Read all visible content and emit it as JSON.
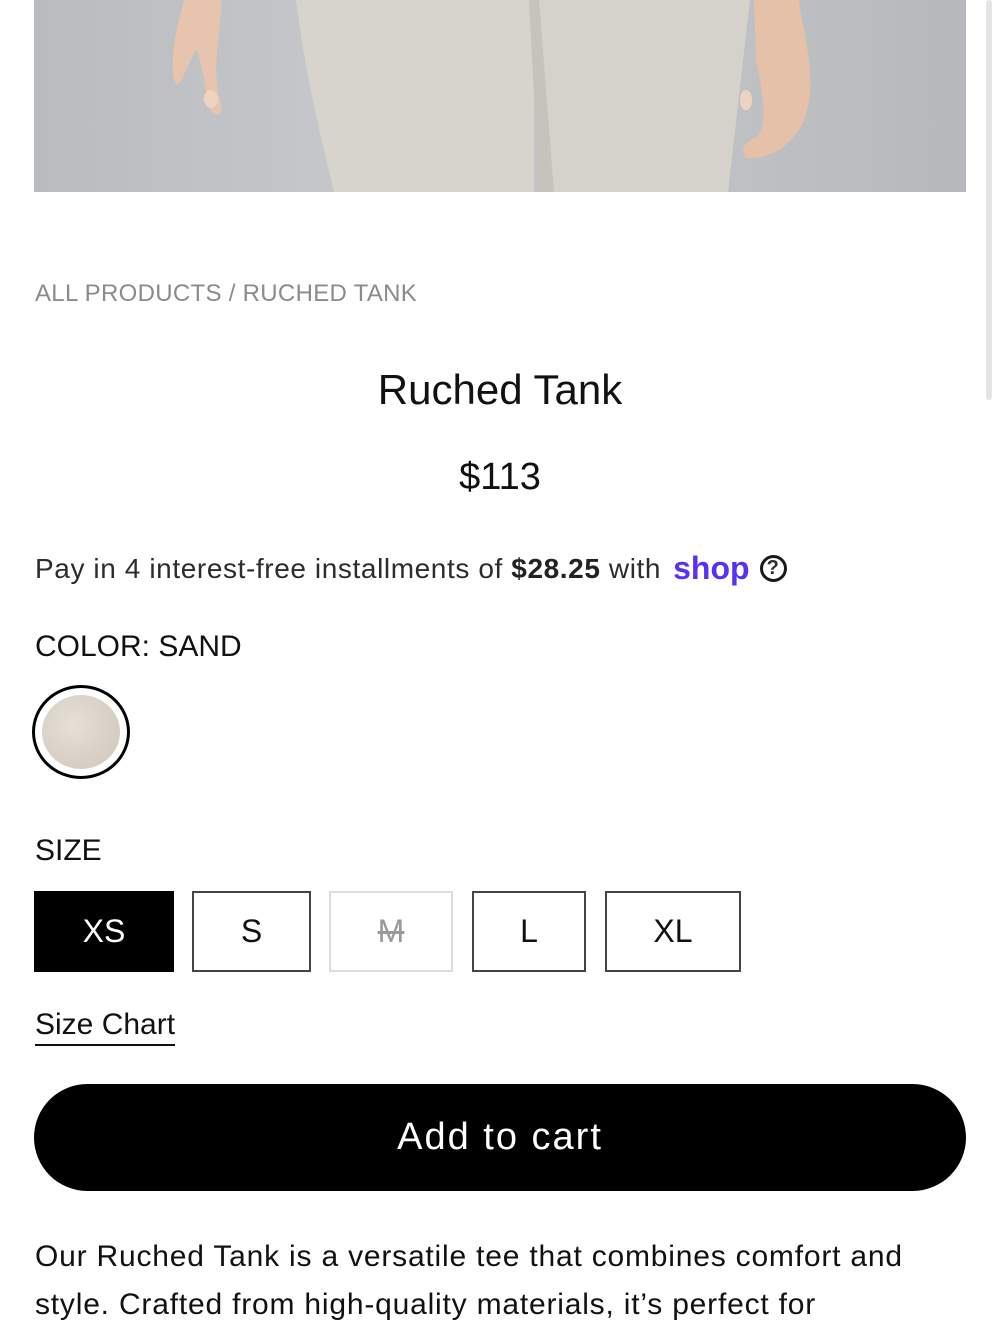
{
  "breadcrumb": {
    "root": "ALL PRODUCTS",
    "separator": " / ",
    "current": "RUCHED TANK"
  },
  "product": {
    "title": "Ruched Tank",
    "price": "$113"
  },
  "installments": {
    "prefix": "Pay in 4 interest-free installments of ",
    "amount": "$28.25",
    "suffix": " with",
    "provider": "shop",
    "help_glyph": "?"
  },
  "color": {
    "label": "COLOR: SAND",
    "selected": "Sand",
    "swatch_hex": "#d9d1c7"
  },
  "size": {
    "label": "SIZE",
    "options": [
      {
        "label": "XS",
        "state": "selected"
      },
      {
        "label": "S",
        "state": "available"
      },
      {
        "label": "M",
        "state": "sold-out"
      },
      {
        "label": "L",
        "state": "available"
      },
      {
        "label": "XL",
        "state": "available"
      }
    ]
  },
  "size_chart_link": "Size Chart",
  "add_to_cart": "Add to cart",
  "description": "Our Ruched Tank is a versatile tee that combines comfort and style. Crafted from high-quality materials, it’s perfect for",
  "colors": {
    "accent_shop": "#5a31f4",
    "primary_button": "#000000",
    "breadcrumb_text": "#8b8b8b"
  },
  "icons": [
    "help-circle-icon"
  ]
}
